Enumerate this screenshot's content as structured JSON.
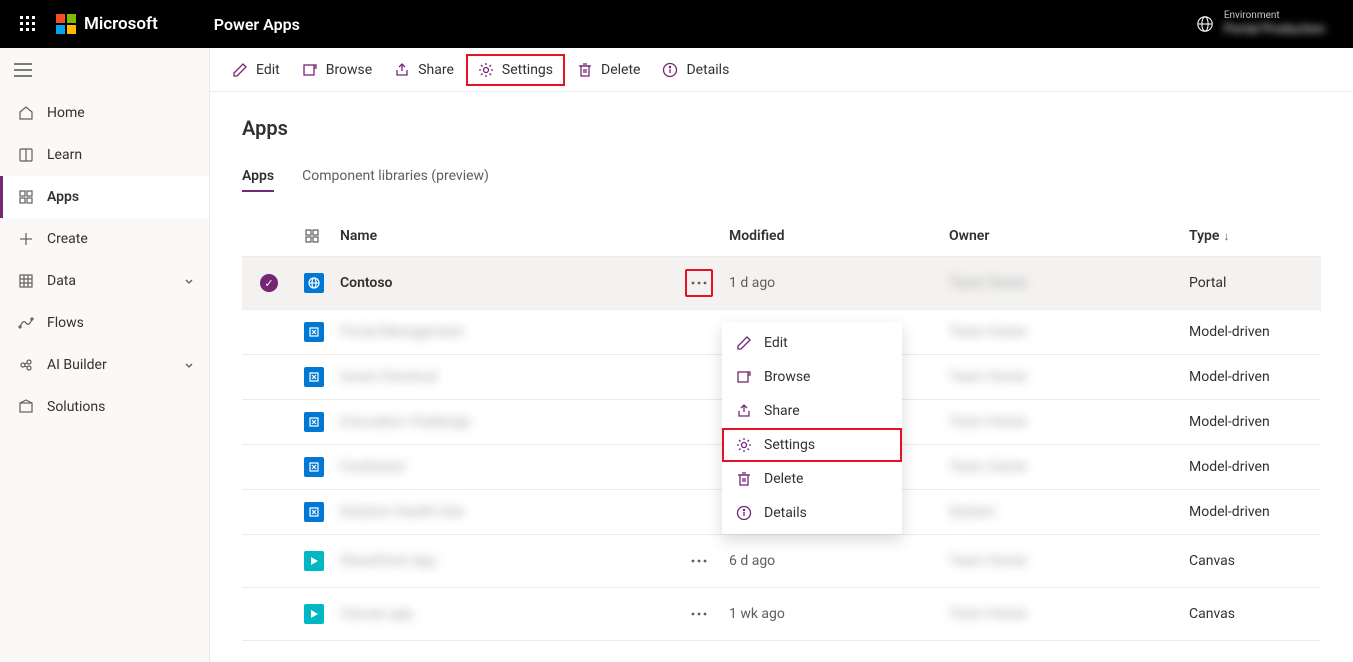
{
  "header": {
    "brand": "Microsoft",
    "product": "Power Apps",
    "env_label": "Environment",
    "env_name": "Portal Production"
  },
  "sidebar": {
    "items": [
      {
        "label": "Home",
        "icon": "home"
      },
      {
        "label": "Learn",
        "icon": "book"
      },
      {
        "label": "Apps",
        "icon": "apps",
        "active": true
      },
      {
        "label": "Create",
        "icon": "plus"
      },
      {
        "label": "Data",
        "icon": "grid",
        "chevron": true
      },
      {
        "label": "Flows",
        "icon": "flow"
      },
      {
        "label": "AI Builder",
        "icon": "ai",
        "chevron": true
      },
      {
        "label": "Solutions",
        "icon": "package"
      }
    ]
  },
  "cmdbar": {
    "edit": "Edit",
    "browse": "Browse",
    "share": "Share",
    "settings": "Settings",
    "delete": "Delete",
    "details": "Details"
  },
  "page": {
    "title": "Apps",
    "tabs": {
      "apps": "Apps",
      "libs": "Component libraries (preview)"
    }
  },
  "table": {
    "headers": {
      "name": "Name",
      "modified": "Modified",
      "owner": "Owner",
      "type": "Type"
    },
    "rows": [
      {
        "name": "Contoso",
        "modified": "1 d ago",
        "owner": "Team Owner",
        "type": "Portal",
        "icon": "portal",
        "selected": true,
        "blurName": false
      },
      {
        "name": "Portal Management",
        "modified": "",
        "owner": "Team Owner",
        "type": "Model-driven",
        "icon": "model",
        "blurName": true
      },
      {
        "name": "Asset Checkout",
        "modified": "",
        "owner": "Team Owner",
        "type": "Model-driven",
        "icon": "model",
        "blurName": true
      },
      {
        "name": "Innovation Challenge",
        "modified": "",
        "owner": "Team Owner",
        "type": "Model-driven",
        "icon": "model",
        "blurName": true
      },
      {
        "name": "Fundraiser",
        "modified": "",
        "owner": "Team Owner",
        "type": "Model-driven",
        "icon": "model",
        "blurName": true
      },
      {
        "name": "Solution Health Hub",
        "modified": "",
        "owner": "System",
        "type": "Model-driven",
        "icon": "model",
        "blurName": true
      },
      {
        "name": "SharePoint App",
        "modified": "6 d ago",
        "owner": "Team Owner",
        "type": "Canvas",
        "icon": "canvas",
        "blurName": true
      },
      {
        "name": "Canvas app",
        "modified": "1 wk ago",
        "owner": "Team Owner",
        "type": "Canvas",
        "icon": "canvas",
        "blurName": true
      }
    ]
  },
  "context_menu": {
    "edit": "Edit",
    "browse": "Browse",
    "share": "Share",
    "settings": "Settings",
    "delete": "Delete",
    "details": "Details"
  }
}
